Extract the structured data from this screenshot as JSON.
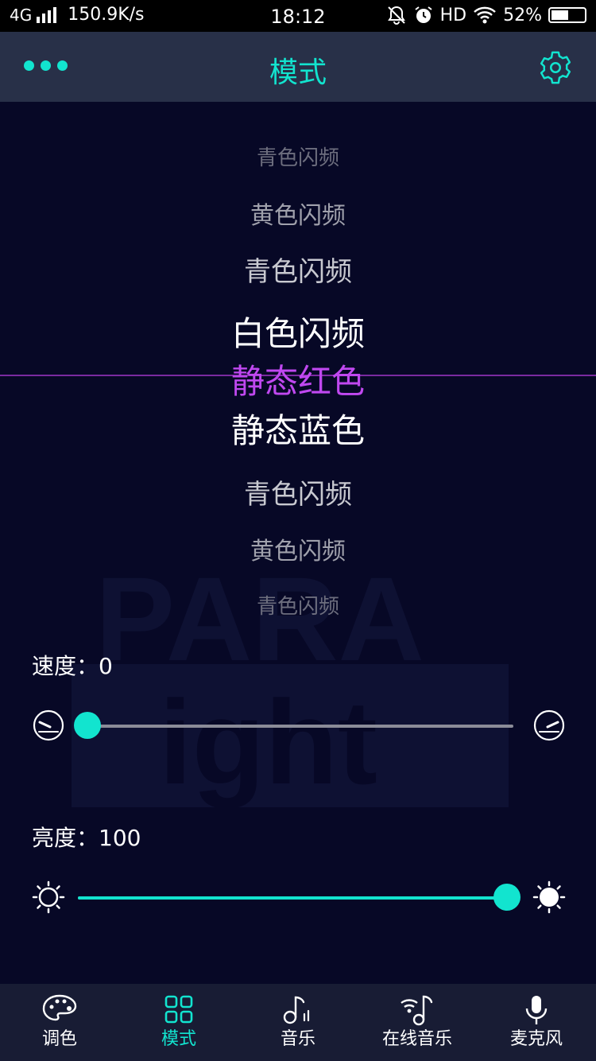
{
  "status_bar": {
    "network": "4G",
    "speed": "150.9K/s",
    "time": "18:12",
    "hd": "HD",
    "battery": "52%",
    "battery_level": 0.52
  },
  "header": {
    "title": "模式",
    "menu_icon": "more-dots-icon",
    "settings_icon": "gear-icon"
  },
  "picker": {
    "items": [
      "青色闪频",
      "黄色闪频",
      "青色闪频",
      "白色闪频",
      "静态红色",
      "静态蓝色",
      "青色闪频",
      "黄色闪频",
      "青色闪频"
    ],
    "selected": "静态红色"
  },
  "watermark": {
    "line1": "PARA",
    "line2": "ight"
  },
  "speed": {
    "label": "速度：",
    "value": "0",
    "level": 0
  },
  "brightness": {
    "label": "亮度：",
    "value": "100",
    "level": 1
  },
  "tabs": [
    {
      "label": "调色",
      "icon": "palette-icon",
      "active": false
    },
    {
      "label": "模式",
      "icon": "grid-icon",
      "active": true
    },
    {
      "label": "音乐",
      "icon": "music-note-icon",
      "active": false
    },
    {
      "label": "在线音乐",
      "icon": "online-music-icon",
      "active": false
    },
    {
      "label": "麦克风",
      "icon": "microphone-icon",
      "active": false
    }
  ],
  "colors": {
    "accent": "#12e4cf",
    "selected_text": "#c048f0",
    "background": "#070826",
    "header": "#283048",
    "tabbar": "#181c34"
  }
}
